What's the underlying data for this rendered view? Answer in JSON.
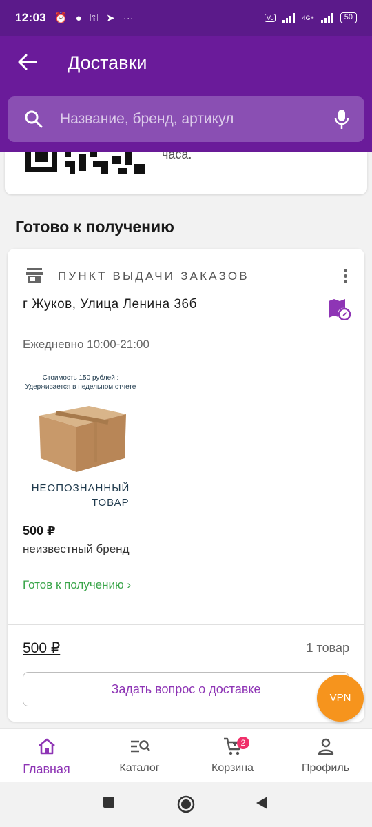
{
  "status_bar": {
    "time": "12:03",
    "battery": "50"
  },
  "header": {
    "title": "Доставки",
    "search_placeholder": "Название, бренд, артикул"
  },
  "top_card": {
    "partial_text": "часа."
  },
  "section_title": "Готово к получению",
  "pickup": {
    "type_label": "ПУНКТ ВЫДАЧИ ЗАКАЗОВ",
    "address": "г Жуков, Улица Ленина 36б",
    "hours": "Ежедневно 10:00-21:00"
  },
  "product": {
    "image_caption_line1": "Стоимость 150 рублей :",
    "image_caption_line2": "Удерживается в недельном отчете",
    "image_label_line1": "НЕОПОЗНАННЫЙ",
    "image_label_line2": "ТОВАР",
    "price": "500 ₽",
    "brand": "неизвестный бренд",
    "status": "Готов к получению ›"
  },
  "summary": {
    "total": "500 ₽",
    "count": "1 товар"
  },
  "ask_button": "Задать вопрос о доставке",
  "vpn_label": "VPN",
  "bottom_nav": [
    {
      "label": "Главная",
      "icon": "home-icon",
      "active": true
    },
    {
      "label": "Каталог",
      "icon": "catalog-search-icon"
    },
    {
      "label": "Корзина",
      "icon": "cart-icon",
      "badge": "2"
    },
    {
      "label": "Профиль",
      "icon": "profile-icon"
    }
  ],
  "colors": {
    "primary": "#6a1b9a",
    "accent": "#8e35b5",
    "success": "#3aa54a",
    "vpn": "#f6941d",
    "badge": "#f0306a"
  }
}
